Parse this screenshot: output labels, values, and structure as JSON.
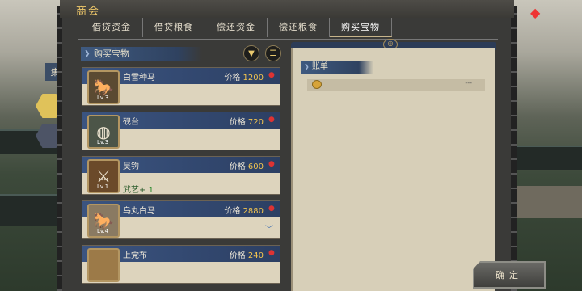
{
  "title": "商会",
  "tabs": [
    {
      "label": "借贷资金"
    },
    {
      "label": "借贷粮食"
    },
    {
      "label": "偿还资金"
    },
    {
      "label": "偿还粮食"
    },
    {
      "label": "购买宝物"
    }
  ],
  "side_tab_label": "集",
  "list": {
    "header": "购买宝物",
    "items": [
      {
        "name": "白雪种马",
        "price_label": "价格",
        "price": "1200",
        "level": "Lv.3",
        "stat": "",
        "stat_value": ""
      },
      {
        "name": "砚台",
        "price_label": "价格",
        "price": "720",
        "level": "Lv.3",
        "stat": "",
        "stat_value": ""
      },
      {
        "name": "吴钩",
        "price_label": "价格",
        "price": "600",
        "level": "Lv.1",
        "stat": "武艺+",
        "stat_value": "1"
      },
      {
        "name": "乌丸白马",
        "price_label": "价格",
        "price": "2880",
        "level": "Lv.4",
        "stat": "",
        "stat_value": ""
      },
      {
        "name": "上党布",
        "price_label": "价格",
        "price": "240",
        "level": "",
        "stat": "",
        "stat_value": ""
      }
    ]
  },
  "ledger": {
    "header": "账单",
    "row_value": "---"
  },
  "confirm_label": "确定",
  "icons": [
    "filter-icon",
    "sort-icon",
    "coin-icon",
    "kite-icon"
  ],
  "colors": {
    "price": "#f2c44f",
    "header_blue": "#3b5480",
    "parchment": "#ddd4bd"
  }
}
